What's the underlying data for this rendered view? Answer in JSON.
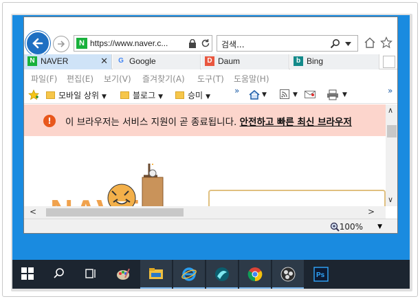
{
  "window": {
    "minimize": "—",
    "maximize": "☐",
    "close": "✕"
  },
  "address": {
    "url": "https://www.naver.c...",
    "favicon": "N"
  },
  "search": {
    "placeholder": "검색..."
  },
  "tabs": [
    {
      "label": "NAVER",
      "favicon": "N",
      "color": "#19b13c",
      "active": true,
      "close": "✕"
    },
    {
      "label": "Google",
      "favicon": "G",
      "color": "#4285f4"
    },
    {
      "label": "Daum",
      "favicon": "D",
      "color": "#e9573f"
    },
    {
      "label": "Bing",
      "favicon": "b",
      "color": "#138a8a"
    }
  ],
  "menu": [
    "파일(F)",
    "편집(E)",
    "보기(V)",
    "즐겨찾기(A)",
    "도구(T)",
    "도움말(H)"
  ],
  "favorites": {
    "items": [
      "모바일 상위",
      "블로그",
      "승미"
    ],
    "more": "»"
  },
  "banner": {
    "text": "이 브라우저는 서비스 지원이 곧 종료됩니다. ",
    "link": "안전하고 빠른 최신 브라우저 "
  },
  "content": {
    "logo": "NAVER"
  },
  "status": {
    "zoom": "100%"
  },
  "taskbar": {
    "items": [
      "start-icon",
      "search-icon",
      "task-view-icon",
      "paint-icon",
      "file-explorer-icon",
      "edge-icon",
      "app-icon",
      "chrome-icon",
      "obs-icon",
      "photoshop-icon"
    ]
  }
}
